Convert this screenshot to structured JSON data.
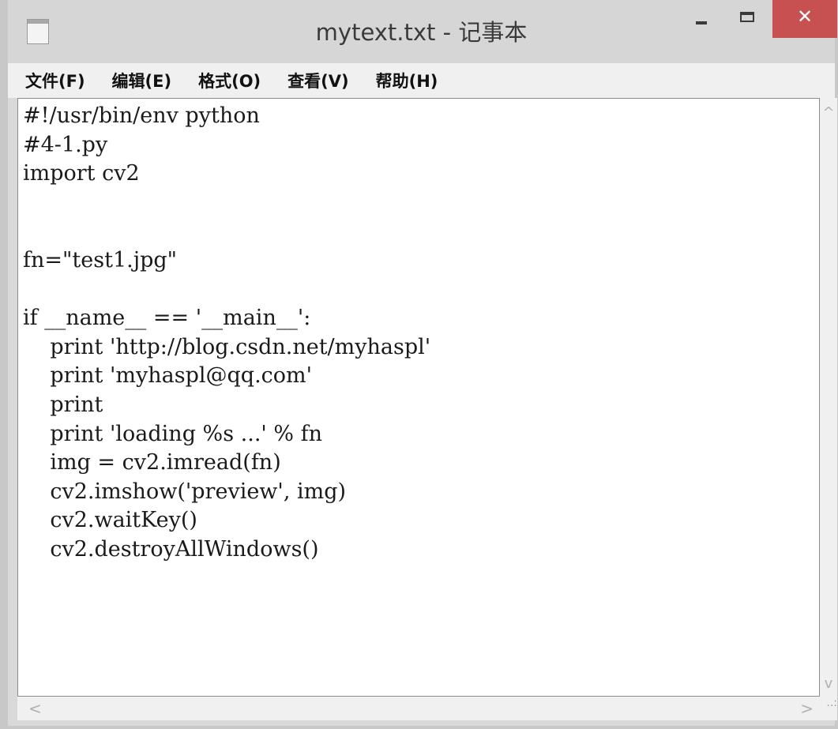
{
  "window": {
    "title": "mytext.txt - 记事本",
    "controls": {
      "minimize_icon": "minimize-icon",
      "maximize_icon": "maximize-icon",
      "close_icon": "close-icon",
      "close_glyph": "✕"
    }
  },
  "menu": {
    "items": [
      "文件(F)",
      "编辑(E)",
      "格式(O)",
      "查看(V)",
      "帮助(H)"
    ]
  },
  "editor": {
    "content": "#!/usr/bin/env python\n#4-1.py\nimport cv2\n\n\nfn=\"test1.jpg\"\n\nif __name__ == '__main__':\n    print 'http://blog.csdn.net/myhaspl'\n    print 'myhaspl@qq.com'\n    print\n    print 'loading %s ...' % fn\n    img = cv2.imread(fn)\n    cv2.imshow('preview', img)\n    cv2.waitKey()\n    cv2.destroyAllWindows()"
  },
  "scrollbars": {
    "up": "^",
    "down": "v",
    "left": "<",
    "right": ">",
    "grip": "..:"
  },
  "colors": {
    "titlebar": "#d6d6d6",
    "close_button": "#c75050",
    "menubar": "#f0f0f0",
    "editor_bg": "#ffffff"
  }
}
